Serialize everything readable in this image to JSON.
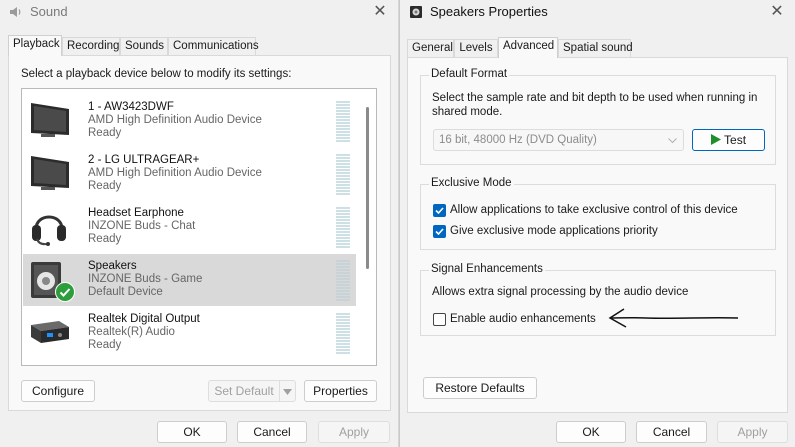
{
  "sound_window": {
    "title": "Sound",
    "close_glyph": "✕",
    "tabs": [
      "Playback",
      "Recording",
      "Sounds",
      "Communications"
    ],
    "active_tab": "Playback",
    "instruction": "Select a playback device below to modify its settings:",
    "devices": [
      {
        "name": "1 - AW3423DWF",
        "description": "AMD High Definition Audio Device",
        "status": "Ready",
        "icon": "monitor-icon",
        "selected": false
      },
      {
        "name": "2 - LG ULTRAGEAR+",
        "description": "AMD High Definition Audio Device",
        "status": "Ready",
        "icon": "monitor-icon",
        "selected": false
      },
      {
        "name": "Headset Earphone",
        "description": "INZONE Buds - Chat",
        "status": "Ready",
        "icon": "headset-icon",
        "selected": false
      },
      {
        "name": "Speakers",
        "description": "INZONE Buds - Game",
        "status": "Default Device",
        "icon": "speaker-icon",
        "selected": true
      },
      {
        "name": "Realtek Digital Output",
        "description": "Realtek(R) Audio",
        "status": "Ready",
        "icon": "digital-output-icon",
        "selected": false
      }
    ],
    "configure_label": "Configure",
    "set_default_label": "Set Default",
    "properties_label": "Properties",
    "ok_label": "OK",
    "cancel_label": "Cancel",
    "apply_label": "Apply"
  },
  "properties_window": {
    "title": "Speakers Properties",
    "close_glyph": "✕",
    "tabs": [
      "General",
      "Levels",
      "Advanced",
      "Spatial sound"
    ],
    "active_tab": "Advanced",
    "default_format": {
      "label": "Default Format",
      "description": "Select the sample rate and bit depth to be used when running in shared mode.",
      "selected_format": "16 bit, 48000 Hz (DVD Quality)",
      "test_label": "Test"
    },
    "exclusive_mode": {
      "label": "Exclusive Mode",
      "allow_exclusive_label": "Allow applications to take exclusive control of this device",
      "allow_exclusive_checked": true,
      "priority_label": "Give exclusive mode applications priority",
      "priority_checked": true
    },
    "signal_enhancements": {
      "label": "Signal Enhancements",
      "description": "Allows extra signal processing by the audio device",
      "enable_label": "Enable audio enhancements",
      "enable_checked": false
    },
    "restore_defaults_label": "Restore Defaults",
    "ok_label": "OK",
    "cancel_label": "Cancel",
    "apply_label": "Apply"
  },
  "colors": {
    "accent": "#0067c0",
    "selected_row": "#d9d9d9",
    "check_green": "#2e9d3b",
    "play_green": "#1e8f2a"
  }
}
